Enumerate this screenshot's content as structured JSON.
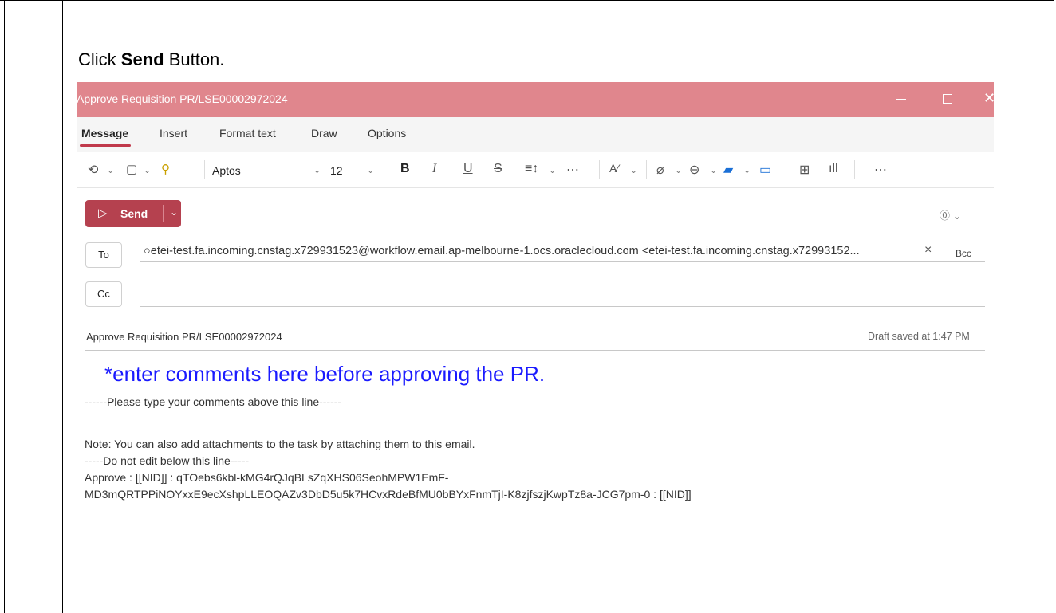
{
  "instruction": {
    "prefix": "Click ",
    "bold": "Send",
    "suffix": " Button."
  },
  "window": {
    "title": "Approve Requisition PR/LSE00002972024",
    "min": "—",
    "close": "✕"
  },
  "ribbon_tabs": [
    "Message",
    "Insert",
    "Format text",
    "Draw",
    "Options"
  ],
  "toolbar": {
    "undo_icon": "⟲",
    "paste_icon": "📋",
    "format_painter_icon": "🖌",
    "font_name": "Aptos",
    "font_size": "12",
    "bold": "B",
    "italic": "I",
    "underline": "U",
    "strike": "S",
    "more": "⋯"
  },
  "send": {
    "label": "Send"
  },
  "recipients": {
    "to_label": "To",
    "to_value": "○etei-test.fa.incoming.cnstag.x729931523@workflow.email.ap-melbourne-1.ocs.oraclecloud.com <etei-test.fa.incoming.cnstag.x72993152...",
    "cc_label": "Cc",
    "bcc_label": "Bcc"
  },
  "subject": "Approve Requisition PR/LSE00002972024",
  "draft_status": "Draft saved at 1:47 PM",
  "annotation": "*enter comments here before approving the PR.",
  "body": {
    "line1": "------Please type your comments above this line------",
    "line2": "Note: You can also add attachments to the task by attaching them to this email.",
    "line3": "-----Do not edit below this line-----",
    "line4": "Approve : [[NID]] : qTOebs6kbl-kMG4rQJqBLsZqXHS06SeohMPW1EmF-",
    "line5": "MD3mQRTPPiNOYxxE9ecXshpLLEOQAZv3DbD5u5k7HCvxRdeBfMU0bBYxFnmTjI-K8zjfszjKwpTz8a-JCG7pm-0 : [[NID]]"
  },
  "colors": {
    "titlebar": "#e0868d",
    "send": "#b5414f",
    "annotation": "#1a1aff"
  }
}
